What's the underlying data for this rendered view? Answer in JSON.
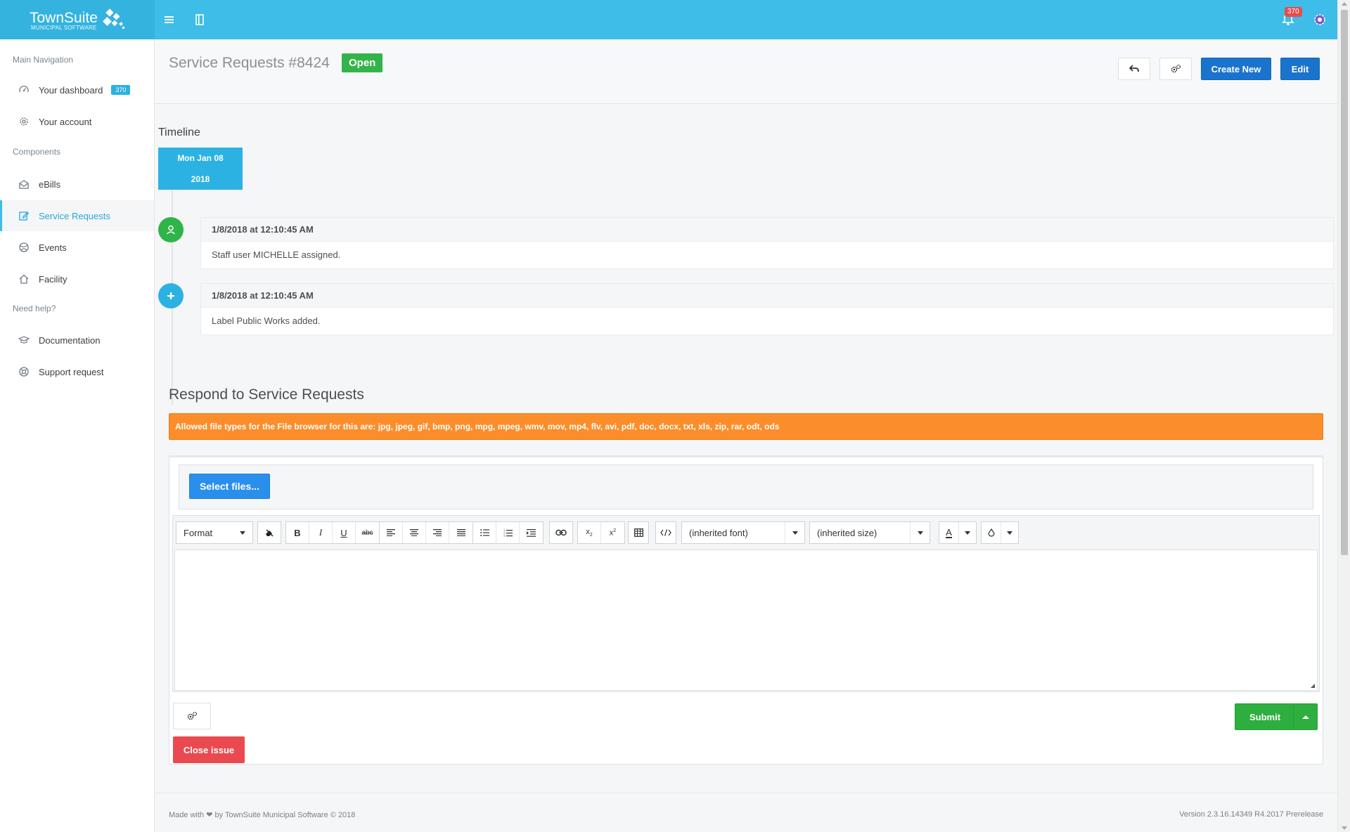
{
  "brand": {
    "name": "TownSuite",
    "subtitle": "MUNICIPAL SOFTWARE"
  },
  "topbar": {
    "notification_count": "370"
  },
  "sidebar": {
    "sections": [
      {
        "heading": "Main Navigation"
      },
      {
        "heading": "Components"
      },
      {
        "heading": "Need help?"
      }
    ],
    "items": [
      {
        "label": "Your dashboard",
        "icon": "dashboard-icon",
        "badge": "370"
      },
      {
        "label": "Your account",
        "icon": "gear-icon"
      },
      {
        "label": "eBills",
        "icon": "envelope-open-icon"
      },
      {
        "label": "Service Requests",
        "icon": "edit-icon",
        "active": true
      },
      {
        "label": "Events",
        "icon": "globe-icon"
      },
      {
        "label": "Facility",
        "icon": "home-icon"
      },
      {
        "label": "Documentation",
        "icon": "graduation-cap-icon"
      },
      {
        "label": "Support request",
        "icon": "lifebuoy-icon"
      }
    ]
  },
  "header": {
    "title": "Service Requests #8424",
    "status": "Open",
    "create_new_label": "Create New",
    "edit_label": "Edit"
  },
  "timeline": {
    "title": "Timeline",
    "date_line1": "Mon Jan 08",
    "date_line2": "2018",
    "entries": [
      {
        "time": "1/8/2018 at 12:10:45 AM",
        "text": "Staff user MICHELLE assigned.",
        "icon": "user-icon",
        "color": "#2fb447"
      },
      {
        "time": "1/8/2018 at 12:10:45 AM",
        "text": "Label Public Works added.",
        "icon": "plus-icon",
        "color": "#2bb2e2"
      }
    ]
  },
  "respond": {
    "title": "Respond to Service Requests",
    "alert": "Allowed file types for the File browser for this are: jpg, jpeg, gif, bmp, png, mpg, mpeg, wmv, mov, mp4, flv, avi, pdf, doc, docx, txt, xls, zip, rar, odt, ods",
    "select_files_label": "Select files...",
    "editor": {
      "format_label": "Format",
      "font_label": "(inherited font)",
      "size_label": "(inherited size)",
      "font_color_glyph": "A"
    },
    "close_label": "Close issue",
    "submit_label": "Submit"
  },
  "footer": {
    "made_with": "Made with",
    "by_text": "by TownSuite Municipal Software © 2018",
    "version": "Version 2.3.16.14349 R4.2017 Prerelease"
  },
  "colors": {
    "topbar": "#3dbde8",
    "open_badge": "#33b44a",
    "primary_button": "#1a73cc",
    "alert": "#fb8d2a",
    "submit": "#2dae3f",
    "close": "#ea4a4f"
  }
}
